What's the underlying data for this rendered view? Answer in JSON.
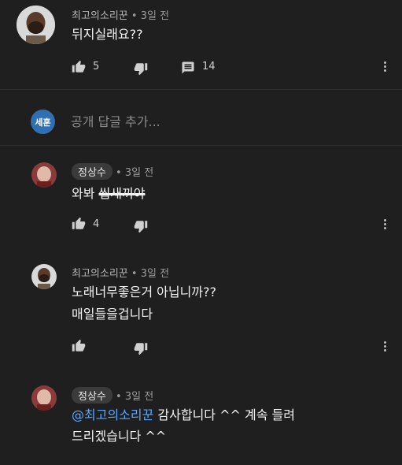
{
  "comments": [
    {
      "author": "최고의소리꾼",
      "time": "3일 전",
      "text": "뒤지실래요??",
      "likes": "5",
      "replies": "14"
    },
    {
      "author": "정상수",
      "time": "3일 전",
      "text_plain": "와봐 ",
      "text_struck": "씹새끼야",
      "likes": "4"
    },
    {
      "author": "최고의소리꾼",
      "time": "3일 전",
      "line1": "노래너무좋은거 아닙니까??",
      "line2": "매일들을겁니다"
    },
    {
      "author": "정상수",
      "time": "3일 전",
      "mention": "@최고의소리꾼",
      "line1_rest": " 감사합니다 ^^ 계속 들려",
      "line2": "드리겠습니다 ^^"
    }
  ],
  "reply_box": {
    "user_initials": "세훈",
    "placeholder": "공개 답글 추가..."
  },
  "separator": "•",
  "icons": [
    "thumb-up-icon",
    "thumb-down-icon",
    "reply-icon",
    "more-vert-icon"
  ]
}
